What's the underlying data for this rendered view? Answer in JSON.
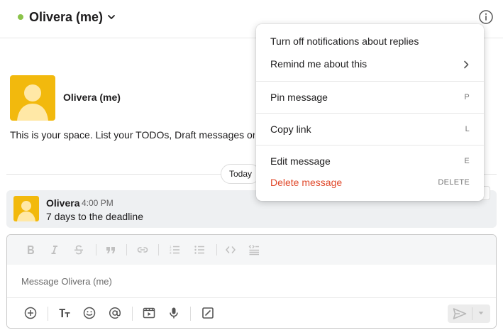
{
  "header": {
    "title": "Olivera (me)",
    "status_color": "#8bc34a",
    "dropdown_icon": "chevron-down-icon",
    "info_icon": "info-icon"
  },
  "intro": {
    "name": "Olivera (me)",
    "description": "This is your space. List your TODOs, Draft messages or k",
    "avatar_color": "#f2b90d"
  },
  "date_divider": {
    "label": "Today"
  },
  "message": {
    "sender": "Olivera",
    "time": "4:00 PM",
    "text": "7 days to the deadline"
  },
  "composer": {
    "placeholder": "Message Olivera (me)",
    "format_tools": [
      "bold-icon",
      "italic-icon",
      "strikethrough-icon",
      "quote-icon",
      "link-icon",
      "ordered-list-icon",
      "bulleted-list-icon",
      "code-icon",
      "code-block-icon"
    ],
    "bottom_tools": [
      "add-icon",
      "text-format-icon",
      "emoji-icon",
      "mention-icon",
      "video-clip-icon",
      "microphone-icon",
      "shortcut-icon"
    ],
    "send_icon": "send-icon"
  },
  "context_menu": {
    "items": [
      {
        "label": "Turn off notifications about replies",
        "shortcut": ""
      },
      {
        "label": "Remind me about this",
        "shortcut": "",
        "submenu": true
      },
      {
        "label": "Pin message",
        "shortcut": "P"
      },
      {
        "label": "Copy link",
        "shortcut": "L"
      },
      {
        "label": "Edit message",
        "shortcut": "E"
      },
      {
        "label": "Delete message",
        "shortcut": "DELETE",
        "danger": true
      }
    ],
    "danger_color": "#e0482a"
  }
}
